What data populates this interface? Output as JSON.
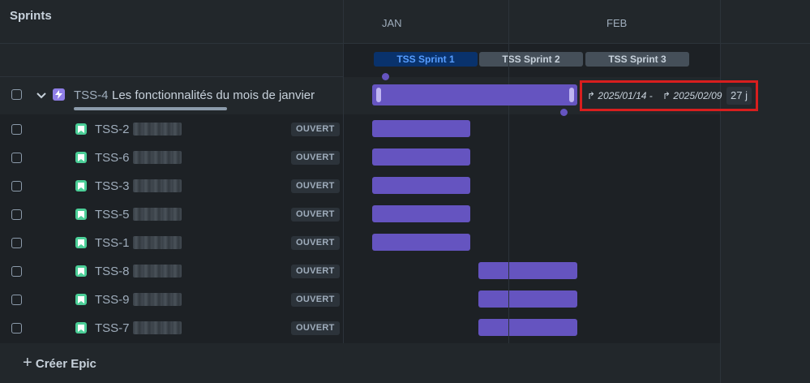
{
  "timeline": {
    "months": [
      "JAN",
      "FEB"
    ]
  },
  "sprints": {
    "label": "Sprints",
    "items": [
      {
        "label": "TSS Sprint 1",
        "active": true
      },
      {
        "label": "TSS Sprint 2",
        "active": false
      },
      {
        "label": "TSS Sprint 3",
        "active": false
      }
    ]
  },
  "epic": {
    "key": "TSS-4",
    "title": "Les fonctionnalités du mois de janvier",
    "start": "2025/01/14 -",
    "end": "2025/02/09",
    "duration": "27 j"
  },
  "issues": [
    {
      "key": "TSS-2",
      "status": "OUVERT"
    },
    {
      "key": "TSS-6",
      "status": "OUVERT"
    },
    {
      "key": "TSS-3",
      "status": "OUVERT"
    },
    {
      "key": "TSS-5",
      "status": "OUVERT"
    },
    {
      "key": "TSS-1",
      "status": "OUVERT"
    },
    {
      "key": "TSS-8",
      "status": "OUVERT"
    },
    {
      "key": "TSS-9",
      "status": "OUVERT"
    },
    {
      "key": "TSS-7",
      "status": "OUVERT"
    }
  ],
  "create": {
    "label": "Créer Epic"
  },
  "colors": {
    "bar": "#6554c0",
    "story_icon": "#4bce97",
    "epic_icon": "#8f7ee7",
    "highlight": "#d81e1e",
    "active_sprint": "#09326c"
  }
}
